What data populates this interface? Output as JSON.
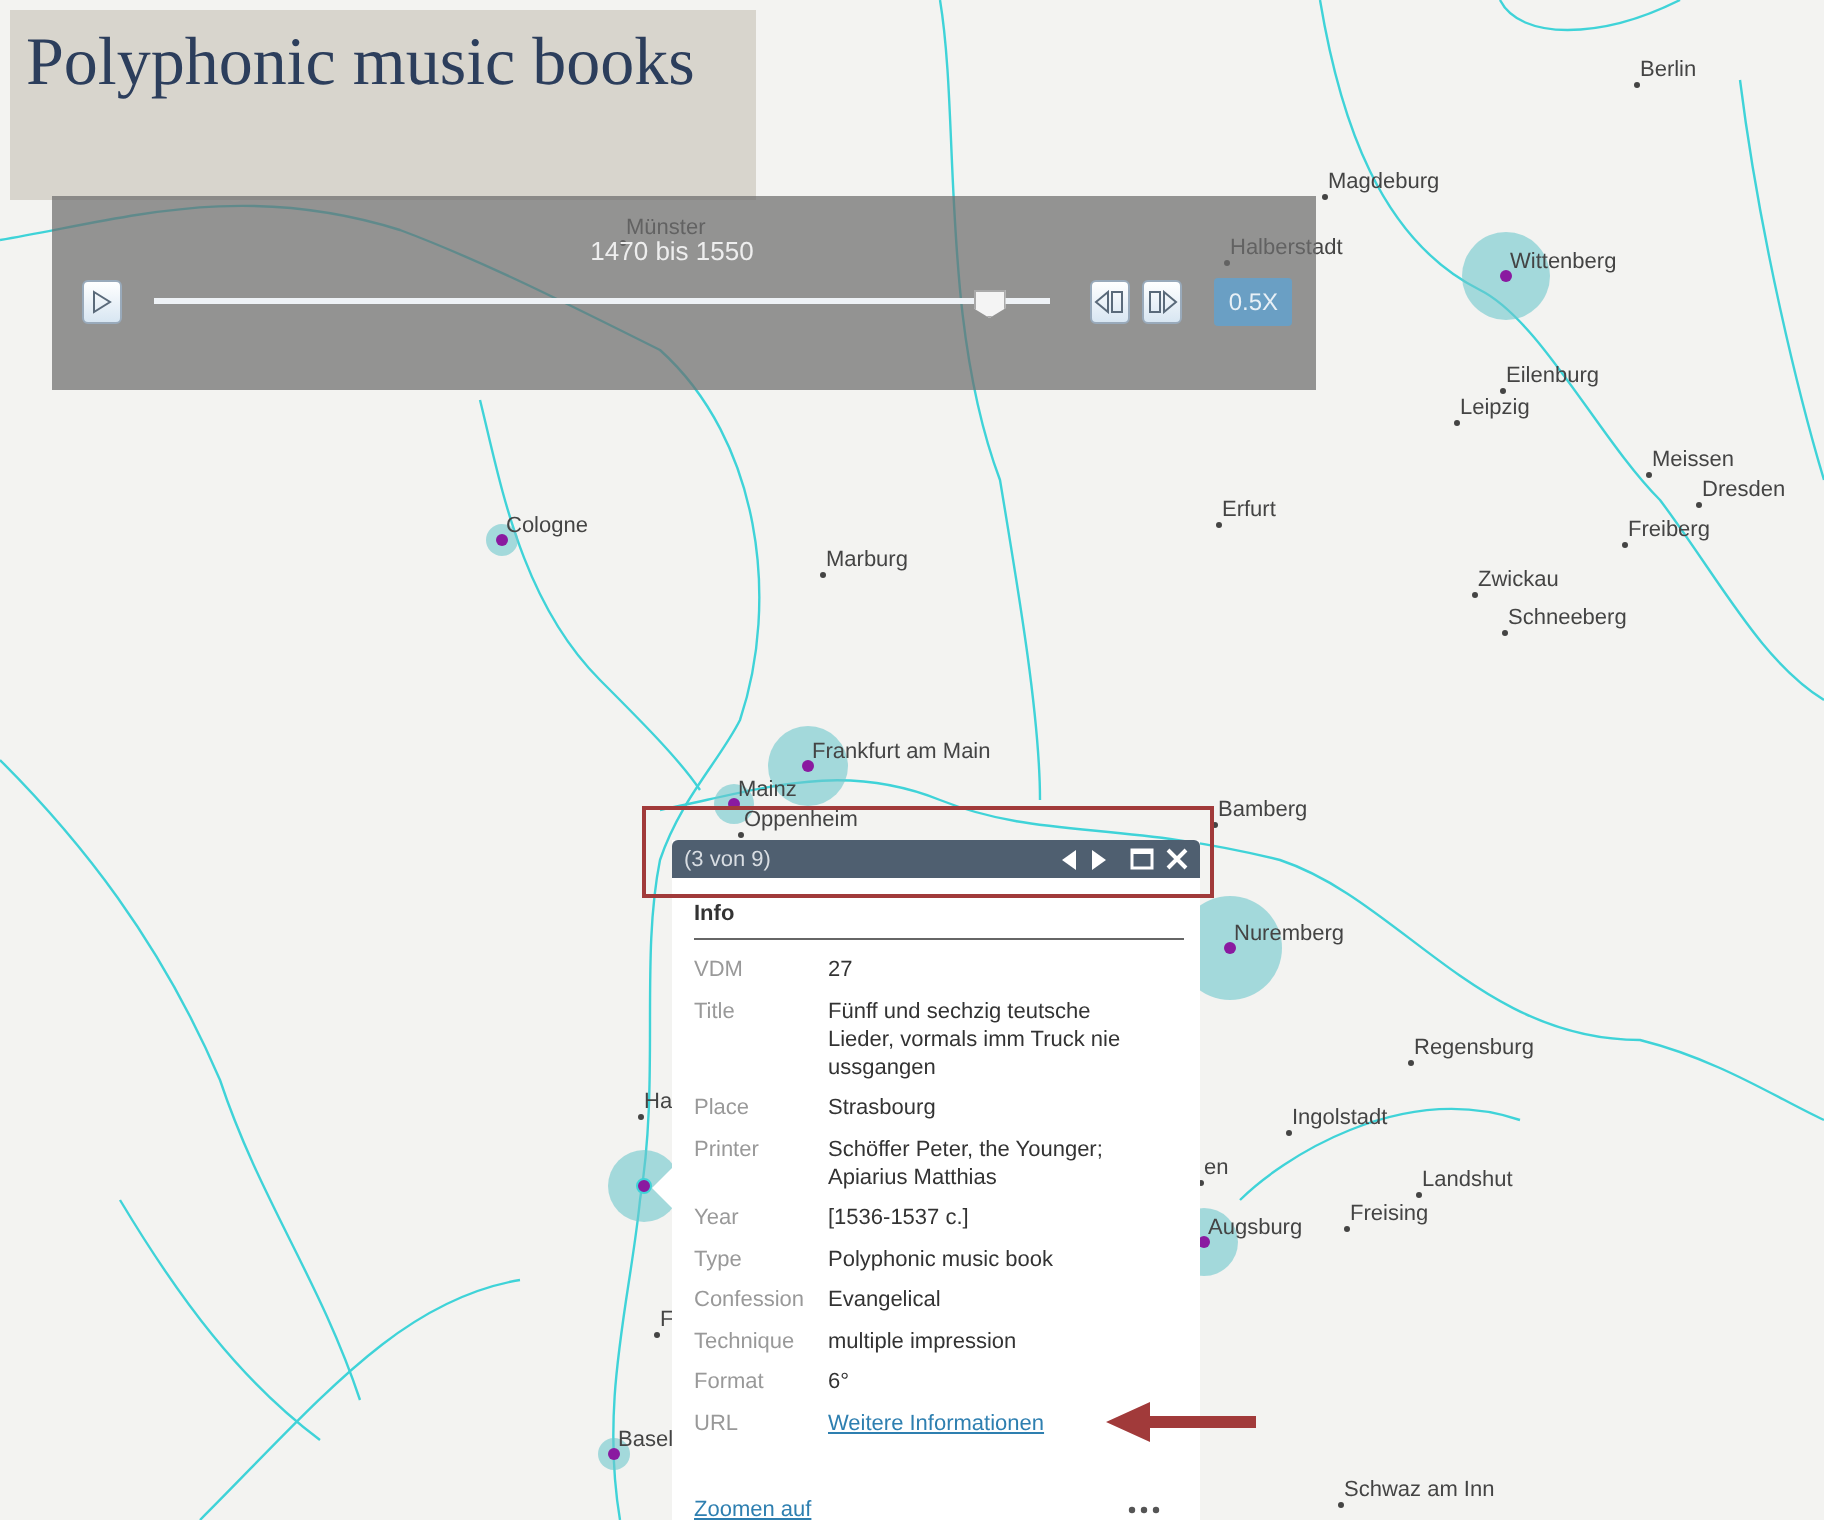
{
  "title": "Polyphonic music books",
  "time_slider": {
    "label": "1470 bis 1550",
    "level": 0.93,
    "speed": "0.5X"
  },
  "cities": [
    {
      "name": "Berlin",
      "books": false,
      "selected": false
    },
    {
      "name": "Magdeburg",
      "books": false,
      "selected": false
    },
    {
      "name": "Münster",
      "books": false,
      "selected": false
    },
    {
      "name": "Halberstadt",
      "books": false,
      "selected": false
    },
    {
      "name": "Wittenberg",
      "books": true,
      "selected": false
    },
    {
      "name": "Eilenburg",
      "books": false,
      "selected": false
    },
    {
      "name": "Leipzig",
      "books": false,
      "selected": false
    },
    {
      "name": "Meissen",
      "books": false,
      "selected": false
    },
    {
      "name": "Dresden",
      "books": false,
      "selected": false
    },
    {
      "name": "Cologne",
      "books": true,
      "selected": false
    },
    {
      "name": "Erfurt",
      "books": false,
      "selected": false
    },
    {
      "name": "Freiberg",
      "books": false,
      "selected": false
    },
    {
      "name": "Marburg",
      "books": false,
      "selected": false
    },
    {
      "name": "Zwickau",
      "books": false,
      "selected": false
    },
    {
      "name": "Schneeberg",
      "books": false,
      "selected": false
    },
    {
      "name": "Frankfurt am Main",
      "books": true,
      "selected": false
    },
    {
      "name": "Mainz",
      "books": true,
      "selected": false
    },
    {
      "name": "Bamberg",
      "books": false,
      "selected": false
    },
    {
      "name": "Oppenheim",
      "books": false,
      "selected": false
    },
    {
      "name": "Nuremberg",
      "books": true,
      "selected": false
    },
    {
      "name": "Regensburg",
      "books": false,
      "selected": false
    },
    {
      "name": "Ha",
      "books": false,
      "selected": false
    },
    {
      "name": "Ingolstadt",
      "books": false,
      "selected": false
    },
    {
      "name": "en",
      "books": false,
      "selected": false
    },
    {
      "name": "Landshut",
      "books": false,
      "selected": false
    },
    {
      "books": true,
      "selected": true
    },
    {
      "name": "Freising",
      "books": false,
      "selected": false
    },
    {
      "name": "Augsburg",
      "books": true,
      "selected": false
    },
    {
      "name": "F",
      "books": false,
      "selected": false
    },
    {
      "name": "Basel",
      "books": true,
      "selected": false
    },
    {
      "name": "Schwaz am Inn",
      "books": false,
      "selected": false
    }
  ],
  "popup": {
    "counter": "(3 von 9)",
    "heading": "Info",
    "fields": [
      {
        "label": "VDM",
        "value": "27",
        "kind": "text"
      },
      {
        "label": "Title",
        "value": "Fünff und sechzig teutsche Lieder, vormals imm Truck nie ussgangen",
        "kind": "text"
      },
      {
        "label": "Place",
        "value": "Strasbourg",
        "kind": "text"
      },
      {
        "label": "Printer",
        "value": "Schöffer Peter, the Younger; Apiarius Matthias",
        "kind": "text"
      },
      {
        "label": "Year",
        "value": "[1536-1537 c.]",
        "kind": "text"
      },
      {
        "label": "Type",
        "value": "Polyphonic music book",
        "kind": "text"
      },
      {
        "label": "Confession",
        "value": "Evangelical",
        "kind": "text"
      },
      {
        "label": "Technique",
        "value": "multiple impression",
        "kind": "text"
      },
      {
        "label": "Format",
        "value": "6°",
        "kind": "text"
      },
      {
        "label": "URL",
        "value": "Weitere Informationen",
        "kind": "link"
      }
    ],
    "zoom_link": "Zoomen auf"
  }
}
